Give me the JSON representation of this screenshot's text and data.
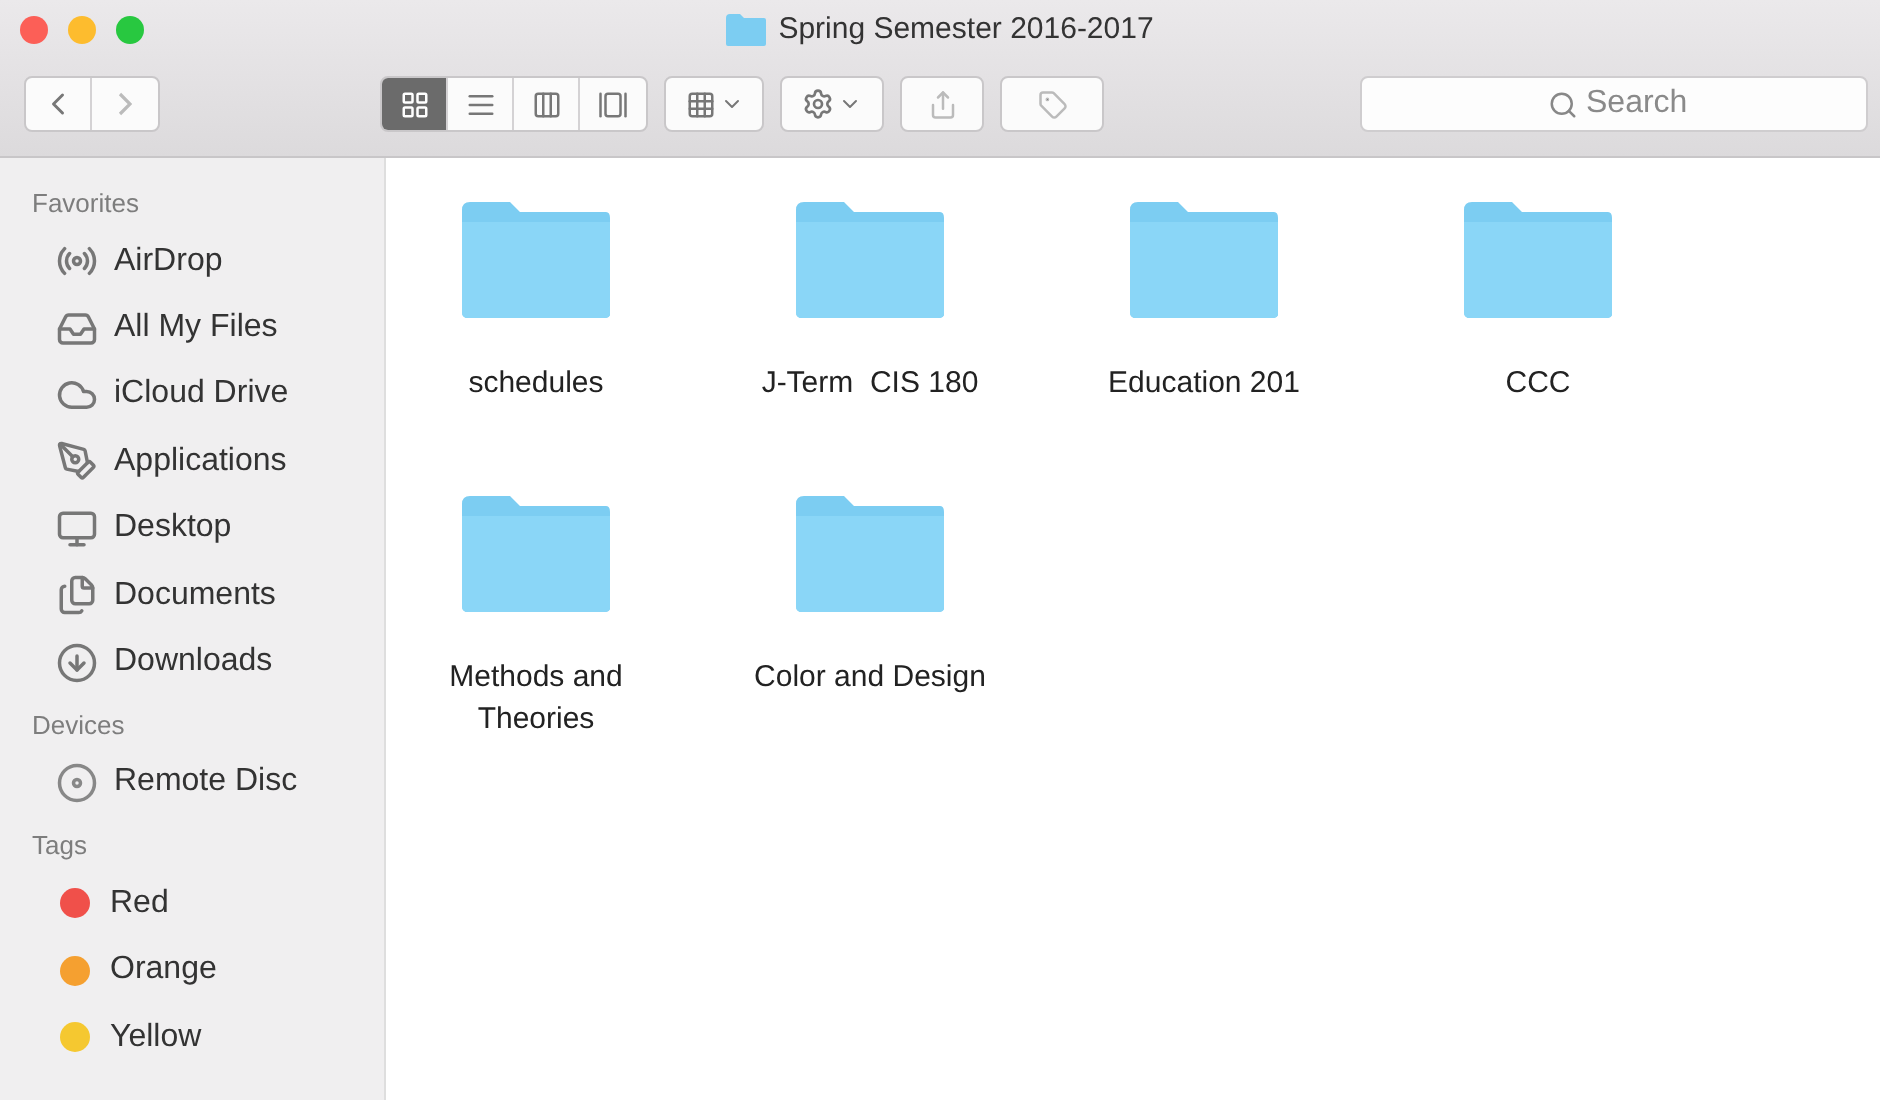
{
  "window": {
    "title": "Spring Semester 2016-2017"
  },
  "toolbar": {
    "view_modes": [
      {
        "selected": true
      },
      {
        "selected": false
      },
      {
        "selected": false
      },
      {
        "selected": false
      }
    ],
    "search": {
      "placeholder": "Search"
    }
  },
  "sidebar": {
    "sections": [
      {
        "title": "Favorites",
        "items": [
          {
            "label": "AirDrop"
          },
          {
            "label": "All My Files"
          },
          {
            "label": "iCloud Drive"
          },
          {
            "label": "Applications"
          },
          {
            "label": "Desktop"
          },
          {
            "label": "Documents"
          },
          {
            "label": "Downloads"
          }
        ]
      },
      {
        "title": "Devices",
        "items": [
          {
            "label": "Remote Disc"
          }
        ]
      },
      {
        "title": "Tags",
        "items": [
          {
            "label": "Red",
            "color": "#f0504a"
          },
          {
            "label": "Orange",
            "color": "#f5a030"
          },
          {
            "label": "Yellow",
            "color": "#f5c830"
          }
        ]
      }
    ]
  },
  "folders": [
    {
      "name": "schedules"
    },
    {
      "name": "J-Term  CIS 180"
    },
    {
      "name": "Education 201"
    },
    {
      "name": "CCC"
    },
    {
      "name": "Methods and Theories"
    },
    {
      "name": "Color and Design"
    }
  ]
}
